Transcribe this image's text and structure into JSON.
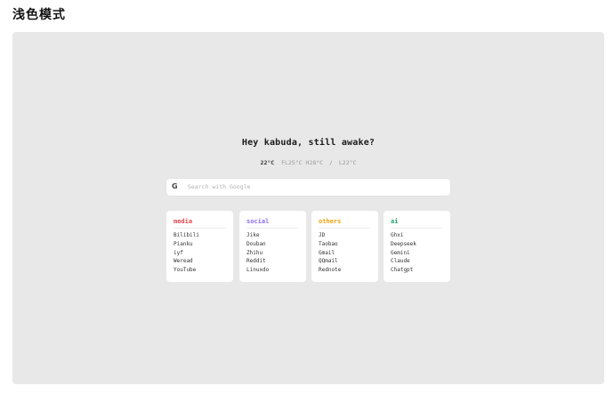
{
  "page": {
    "title": "浅色模式"
  },
  "newtab": {
    "greeting": "Hey kabuda, still awake?",
    "weather": {
      "temp": "22°C",
      "feels_like": "FL25°C",
      "high": "H28°C",
      "separator": "/",
      "low": "L22°C"
    },
    "search": {
      "icon": "G",
      "placeholder": "Search with Google",
      "value": ""
    },
    "groups": [
      {
        "title": "media",
        "color": "#e5484d",
        "links": [
          "Bilibili",
          "Pianku",
          "iyf",
          "Weread",
          "YouTube"
        ]
      },
      {
        "title": "social",
        "color": "#8e6cf0",
        "links": [
          "Jike",
          "Douban",
          "Zhihu",
          "Reddit",
          "Linuxdo"
        ]
      },
      {
        "title": "others",
        "color": "#f2a20c",
        "links": [
          "JD",
          "Taobao",
          "Gmail",
          "QQmail",
          "Rednote"
        ]
      },
      {
        "title": "ai",
        "color": "#22a370",
        "links": [
          "Ghxi",
          "Deepseek",
          "Gemini",
          "Claude",
          "Chatgpt"
        ]
      }
    ]
  }
}
